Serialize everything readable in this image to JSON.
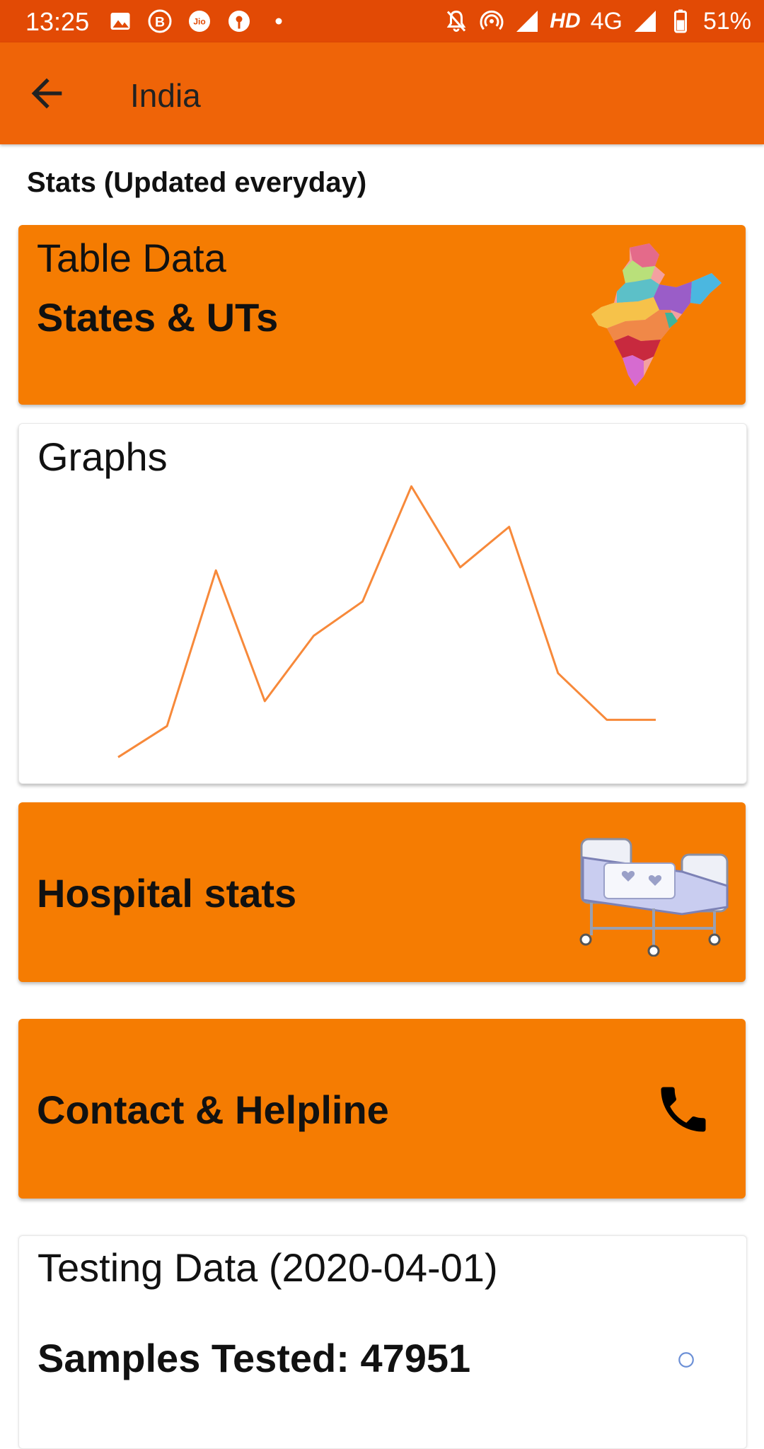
{
  "status_bar": {
    "time": "13:25",
    "network": "HD",
    "network_type": "4G",
    "battery": "51%",
    "icons_left": [
      "image-icon",
      "b-icon",
      "jio-icon",
      "sbi-icon",
      "dot-icon"
    ],
    "icons_right": [
      "bell-off-icon",
      "hotspot-icon",
      "signal-icon",
      "signal-icon",
      "battery-icon"
    ]
  },
  "app_bar": {
    "title": "India",
    "back_icon": "arrow-left-icon"
  },
  "section_heading": "Stats (Updated everyday)",
  "cards": {
    "table": {
      "subtitle": "Table Data",
      "title": "States & UTs",
      "image": "india-map"
    },
    "graph": {
      "title": "Graphs"
    },
    "hospital": {
      "title": "Hospital stats",
      "image": "hospital-bed"
    },
    "contact": {
      "title": "Contact & Helpline",
      "icon": "phone-icon"
    },
    "testing": {
      "title": "Testing Data (2020-04-01)",
      "samples_label": "Samples Tested: 47951"
    }
  },
  "colors": {
    "status_bar": "#e24a05",
    "app_bar": "#ef6408",
    "card_orange": "#f57c02",
    "chart_line": "#f7893a"
  },
  "chart_data": {
    "type": "line",
    "title": "",
    "xlabel": "",
    "ylabel": "",
    "grid": false,
    "legend": "none",
    "x": [
      1,
      2,
      3,
      4,
      5,
      6,
      7,
      8,
      9,
      10,
      11,
      12
    ],
    "series": [
      {
        "values": [
          2,
          12,
          62,
          20,
          41,
          52,
          89,
          63,
          76,
          29,
          14,
          14
        ]
      }
    ],
    "ylim": [
      0,
      100
    ]
  }
}
